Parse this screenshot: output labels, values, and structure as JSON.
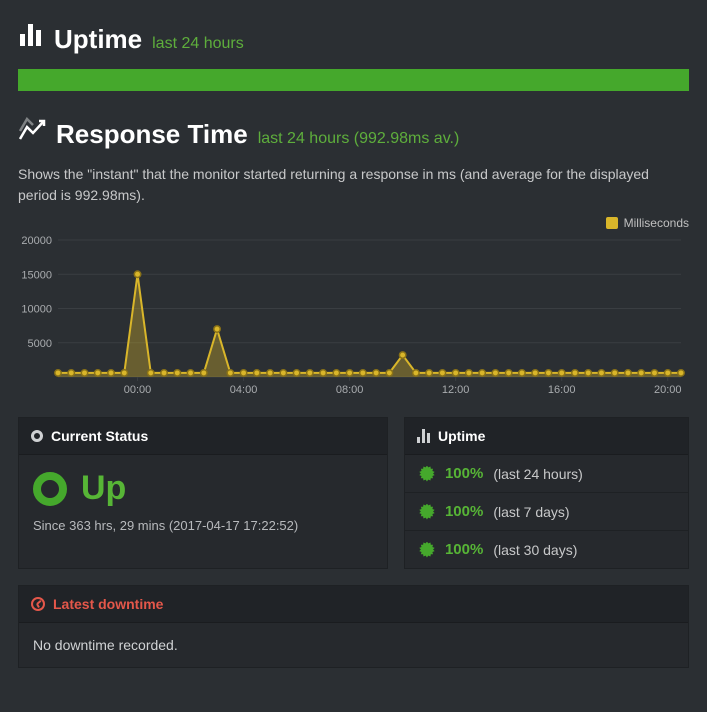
{
  "uptime_section": {
    "title": "Uptime",
    "subtitle": "last 24 hours"
  },
  "response_section": {
    "title": "Response Time",
    "subtitle": "last 24 hours (992.98ms av.)",
    "description": "Shows the \"instant\" that the monitor started returning a response in ms (and average for the displayed period is 992.98ms).",
    "legend_label": "Milliseconds"
  },
  "status_panel": {
    "header": "Current Status",
    "state": "Up",
    "since": "Since 363 hrs, 29 mins (2017-04-17 17:22:52)"
  },
  "uptime_panel": {
    "header": "Uptime",
    "rows": [
      {
        "pct": "100%",
        "period": "(last 24 hours)"
      },
      {
        "pct": "100%",
        "period": "(last 7 days)"
      },
      {
        "pct": "100%",
        "period": "(last 30 days)"
      }
    ]
  },
  "downtime_panel": {
    "header": "Latest downtime",
    "body": "No downtime recorded."
  },
  "chart_data": {
    "type": "area",
    "title": "Response Time",
    "xlabel": "",
    "ylabel": "Milliseconds",
    "ylim": [
      0,
      20000
    ],
    "yticks": [
      5000,
      10000,
      15000,
      20000
    ],
    "xtick_labels": [
      "00:00",
      "04:00",
      "08:00",
      "12:00",
      "16:00",
      "20:00"
    ],
    "x": [
      "21:00",
      "21:30",
      "22:00",
      "22:30",
      "23:00",
      "23:30",
      "00:00",
      "00:30",
      "01:00",
      "01:30",
      "02:00",
      "02:30",
      "03:00",
      "03:30",
      "04:00",
      "04:30",
      "05:00",
      "05:30",
      "06:00",
      "06:30",
      "07:00",
      "07:30",
      "08:00",
      "08:30",
      "09:00",
      "09:30",
      "10:00",
      "10:30",
      "11:00",
      "11:30",
      "12:00",
      "12:30",
      "13:00",
      "13:30",
      "14:00",
      "14:30",
      "15:00",
      "15:30",
      "16:00",
      "16:30",
      "17:00",
      "17:30",
      "18:00",
      "18:30",
      "19:00",
      "19:30",
      "20:00",
      "20:30"
    ],
    "values": [
      600,
      600,
      600,
      600,
      600,
      600,
      15000,
      600,
      600,
      600,
      600,
      600,
      7000,
      600,
      600,
      600,
      600,
      600,
      600,
      600,
      600,
      600,
      600,
      600,
      600,
      600,
      3200,
      600,
      600,
      600,
      600,
      600,
      600,
      600,
      600,
      600,
      600,
      600,
      600,
      600,
      600,
      600,
      600,
      600,
      600,
      600,
      600,
      600
    ],
    "series": [
      {
        "name": "Milliseconds",
        "values": [
          600,
          600,
          600,
          600,
          600,
          600,
          15000,
          600,
          600,
          600,
          600,
          600,
          7000,
          600,
          600,
          600,
          600,
          600,
          600,
          600,
          600,
          600,
          600,
          600,
          600,
          600,
          3200,
          600,
          600,
          600,
          600,
          600,
          600,
          600,
          600,
          600,
          600,
          600,
          600,
          600,
          600,
          600,
          600,
          600,
          600,
          600,
          600,
          600
        ]
      }
    ]
  }
}
